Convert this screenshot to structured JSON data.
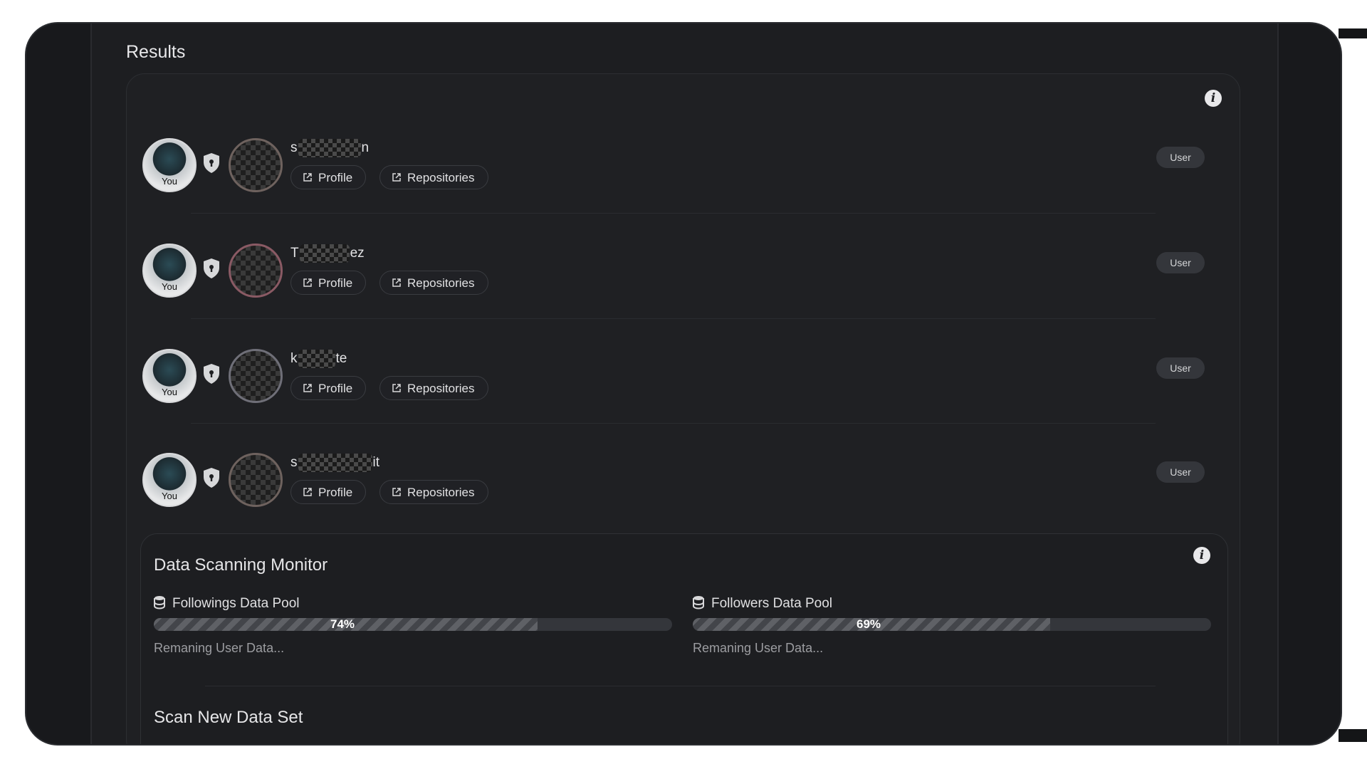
{
  "results": {
    "title": "Results",
    "rows": [
      {
        "you_label": "You",
        "name_start": "s",
        "name_end": "n",
        "profile_label": "Profile",
        "repos_label": "Repositories",
        "badge": "User"
      },
      {
        "you_label": "You",
        "name_start": "T",
        "name_end": "ez",
        "profile_label": "Profile",
        "repos_label": "Repositories",
        "badge": "User"
      },
      {
        "you_label": "You",
        "name_start": "k",
        "name_end": "te",
        "profile_label": "Profile",
        "repos_label": "Repositories",
        "badge": "User"
      },
      {
        "you_label": "You",
        "name_start": "s",
        "name_end": "it",
        "profile_label": "Profile",
        "repos_label": "Repositories",
        "badge": "User"
      }
    ]
  },
  "monitor": {
    "title": "Data Scanning Monitor",
    "pools": [
      {
        "label": "Followings Data Pool",
        "percent_text": "74%",
        "progress": 0.74,
        "status": "Remaning User Data..."
      },
      {
        "label": "Followers Data Pool",
        "percent_text": "69%",
        "progress": 0.69,
        "status": "Remaning User Data..."
      }
    ],
    "scan_title": "Scan New Data Set"
  },
  "icons": {
    "info": "info-icon",
    "shield": "shield-icon",
    "external": "external-link-icon",
    "database": "database-icon"
  },
  "colors": {
    "background": "#18191c",
    "card": "#1f2023",
    "text": "#e3e3e5",
    "muted": "#9c9da1"
  }
}
